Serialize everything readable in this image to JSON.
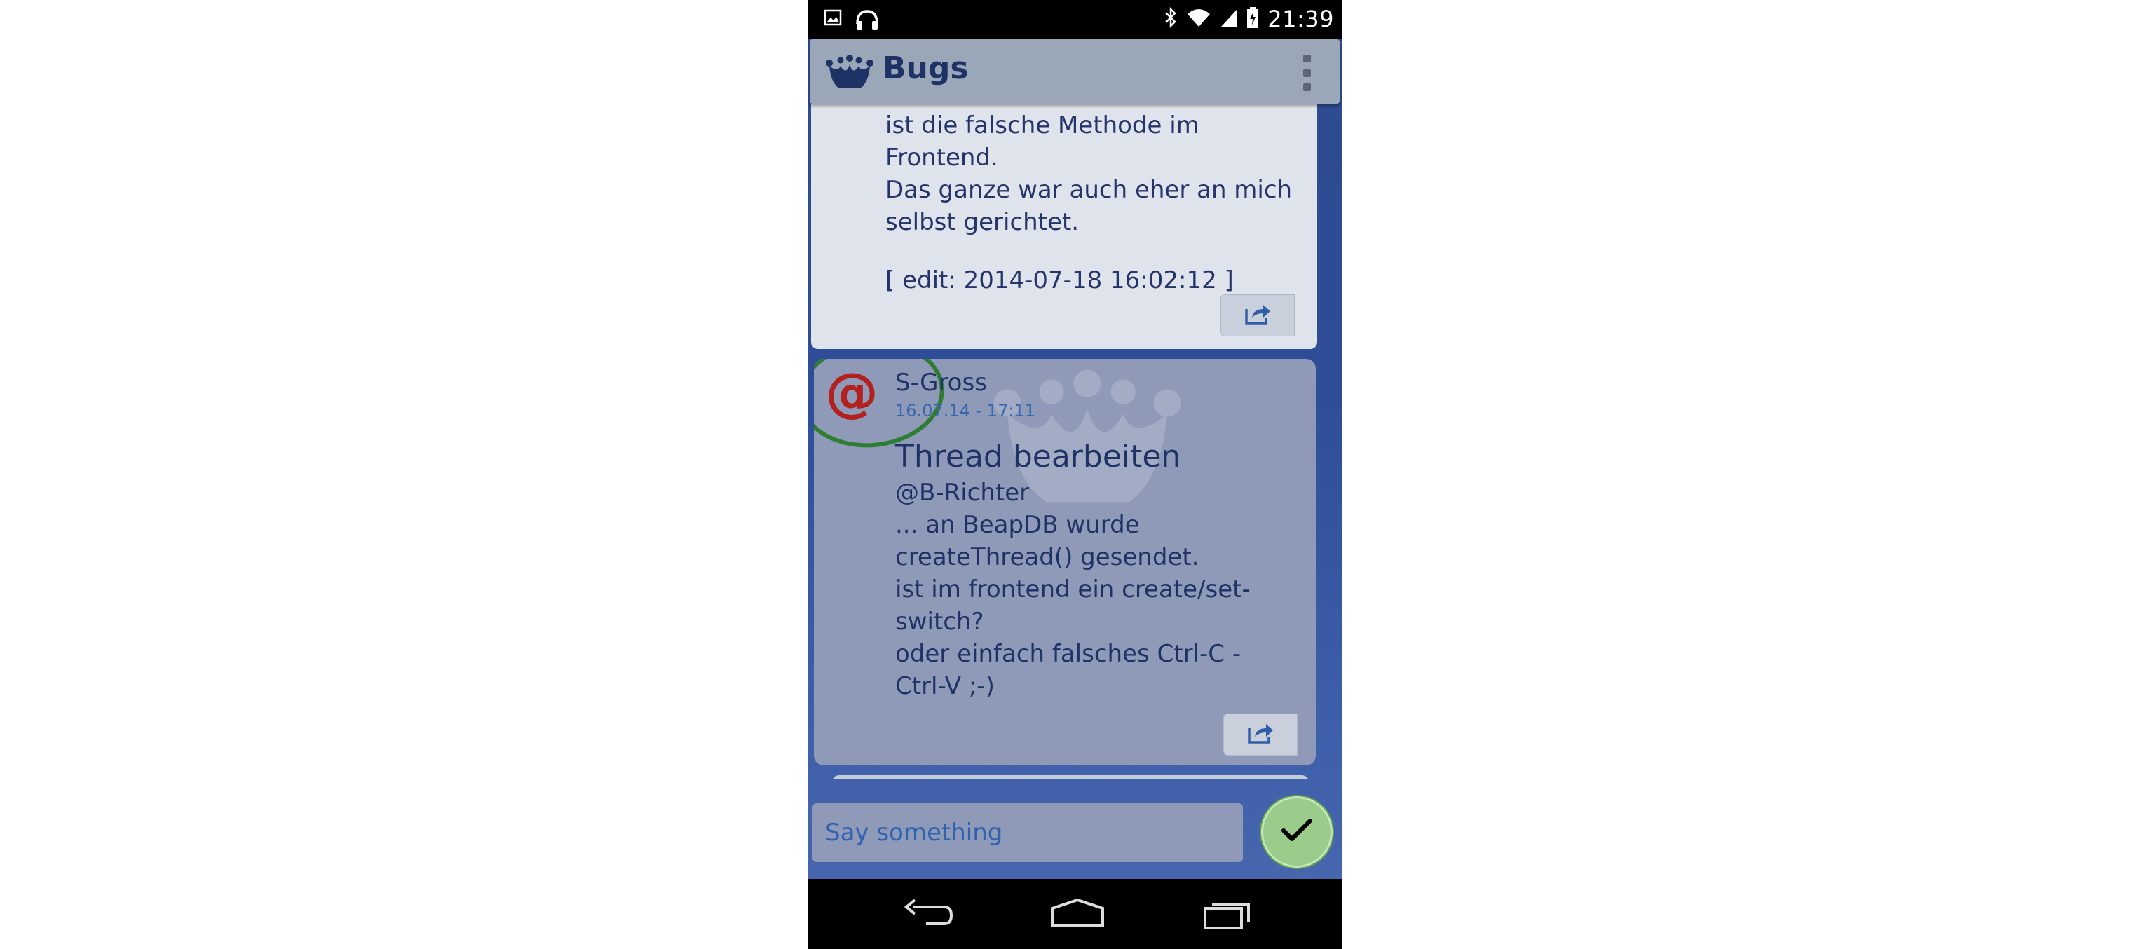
{
  "status_bar": {
    "time": "21:39"
  },
  "action_bar": {
    "title": "Bugs"
  },
  "posts": [
    {
      "body_lines": [
        "ist die falsche Methode im",
        "Frontend.",
        "Das ganze war auch eher an mich",
        "selbst gerichtet."
      ],
      "edit": "[ edit: 2014-07-18 16:02:12 ]"
    },
    {
      "avatar": "@",
      "author": "S-Gross",
      "time": "16.07.14 - 17:11",
      "title": "Thread bearbeiten",
      "body_lines": [
        "@B-Richter",
        "... an BeapDB wurde",
        "createThread() gesendet.",
        "ist im frontend ein create/set-",
        "switch?",
        "oder einfach falsches Ctrl-C -",
        "Ctrl-V ;-)"
      ]
    }
  ],
  "composer": {
    "placeholder": "Say something"
  },
  "colors": {
    "accent": "#1f3266",
    "annotation_ring": "#2e7d32",
    "send_button": "#9ccc8c",
    "avatar": "#b3211e"
  },
  "icons": {
    "status_left": [
      "image-icon",
      "headphones-icon"
    ],
    "status_right": [
      "bluetooth-icon",
      "wifi-icon",
      "signal-icon",
      "battery-icon"
    ],
    "app": "crown-icon",
    "overflow": "overflow-menu-icon",
    "share": "share-icon",
    "send": "checkmark-icon",
    "nav": [
      "back-icon",
      "home-icon",
      "recents-icon"
    ]
  }
}
